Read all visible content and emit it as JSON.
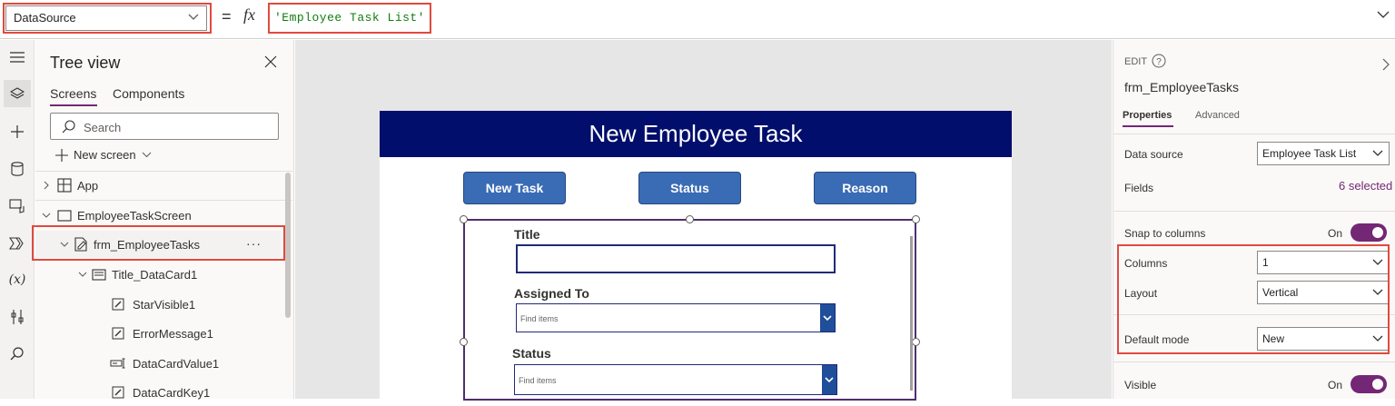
{
  "formula_bar": {
    "property": "DataSource",
    "equals": "=",
    "fx": "fx",
    "formula": "'Employee Task List'"
  },
  "left_rail": {
    "icons": [
      "hamburger-icon",
      "layers-icon",
      "plus-icon",
      "database-icon",
      "media-icon",
      "power-automate-icon",
      "variables-icon",
      "tools-icon",
      "search-icon"
    ],
    "variables_label": "(x)"
  },
  "tree_view": {
    "title": "Tree view",
    "tabs": [
      "Screens",
      "Components"
    ],
    "search_placeholder": "Search",
    "new_screen": "New screen",
    "items": [
      {
        "label": "App"
      },
      {
        "label": "EmployeeTaskScreen"
      },
      {
        "label": "frm_EmployeeTasks",
        "more": "···"
      },
      {
        "label": "Title_DataCard1"
      },
      {
        "label": "StarVisible1"
      },
      {
        "label": "ErrorMessage1"
      },
      {
        "label": "DataCardValue1"
      },
      {
        "label": "DataCardKey1"
      }
    ]
  },
  "canvas": {
    "header": "New Employee Task",
    "buttons": [
      "New Task",
      "Status",
      "Reason"
    ],
    "fields": [
      {
        "label": "Title"
      },
      {
        "label": "Assigned To",
        "placeholder": "Find items"
      },
      {
        "label": "Status",
        "placeholder": "Find items"
      }
    ]
  },
  "properties": {
    "edit_label": "EDIT",
    "control_name": "frm_EmployeeTasks",
    "tabs": [
      "Properties",
      "Advanced"
    ],
    "data_source_label": "Data source",
    "data_source_value": "Employee Task List",
    "fields_label": "Fields",
    "fields_value": "6 selected",
    "snap_label": "Snap to columns",
    "snap_state": "On",
    "columns_label": "Columns",
    "columns_value": "1",
    "layout_label": "Layout",
    "layout_value": "Vertical",
    "default_mode_label": "Default mode",
    "default_mode_value": "New",
    "visible_label": "Visible",
    "visible_state": "On"
  },
  "colors": {
    "accent": "#742774",
    "highlight": "#e04a3f",
    "app_header": "#010e6b",
    "app_button": "#3a6bb5"
  }
}
